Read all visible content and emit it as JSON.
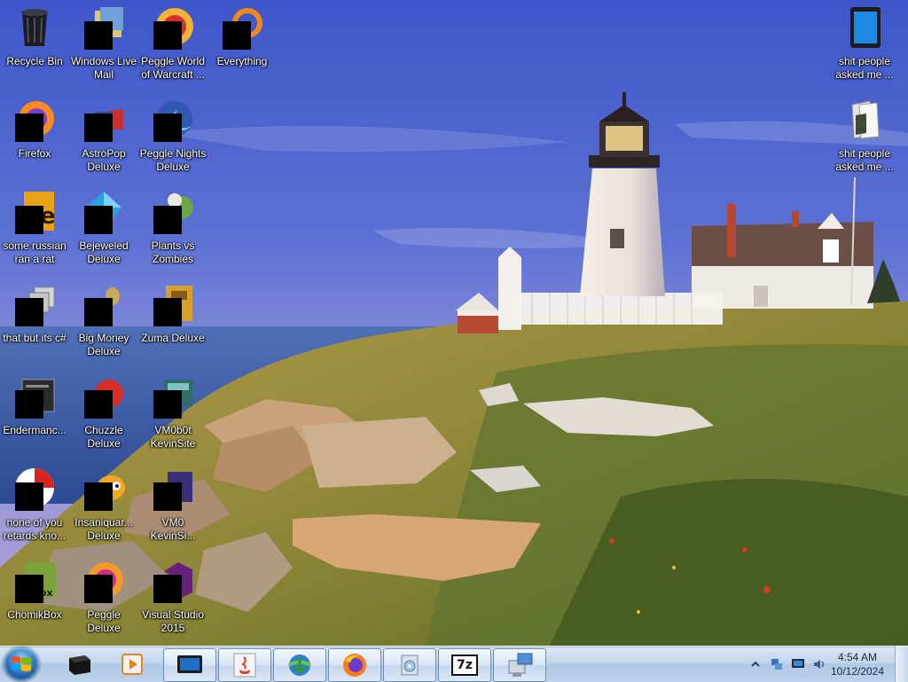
{
  "desktop": {
    "icons": [
      {
        "label": "Recycle Bin",
        "icon": "recycle-bin-icon",
        "name": "icon-recycle-bin"
      },
      {
        "label": "Windows Live Mail",
        "icon": "mail-app-icon",
        "name": "icon-windows-live-mail"
      },
      {
        "label": "Peggle World of Warcraft ...",
        "icon": "game-icon",
        "name": "icon-peggle-wow"
      },
      {
        "label": "Everything",
        "icon": "search-app-icon",
        "name": "icon-everything"
      },
      {
        "label": "Firefox",
        "icon": "firefox-icon",
        "name": "icon-firefox"
      },
      {
        "label": "AstroPop Deluxe",
        "icon": "game-icon",
        "name": "icon-astropop-deluxe"
      },
      {
        "label": "Peggle Nights Deluxe",
        "icon": "game-icon",
        "name": "icon-peggle-nights-deluxe"
      },
      {
        "label": "some russian ran a rat",
        "icon": "app-icon",
        "name": "icon-some-russian-ran-a-rat"
      },
      {
        "label": "Bejeweled Deluxe",
        "icon": "game-icon",
        "name": "icon-bejeweled-deluxe"
      },
      {
        "label": "Plants vs Zombies",
        "icon": "game-icon",
        "name": "icon-plants-vs-zombies"
      },
      {
        "label": "that but its c#",
        "icon": "app-icon",
        "name": "icon-that-but-its-csharp"
      },
      {
        "label": "Big Money Deluxe",
        "icon": "game-icon",
        "name": "icon-big-money-deluxe"
      },
      {
        "label": "Zuma Deluxe",
        "icon": "game-icon",
        "name": "icon-zuma-deluxe"
      },
      {
        "label": "Endermanc...",
        "icon": "terminal-icon",
        "name": "icon-endermanc"
      },
      {
        "label": "Chuzzle Deluxe",
        "icon": "game-icon",
        "name": "icon-chuzzle-deluxe"
      },
      {
        "label": "VM0b0t KevinSite",
        "icon": "app-icon",
        "name": "icon-vm0b0t-kevinsite"
      },
      {
        "label": "none of you retards kno...",
        "icon": "app-icon",
        "name": "icon-none-of-you"
      },
      {
        "label": "Insaniquar... Deluxe",
        "icon": "game-icon",
        "name": "icon-insaniquarium-deluxe"
      },
      {
        "label": "VM0 KevinSi...",
        "icon": "app-icon",
        "name": "icon-vm0-kevinsite"
      },
      {
        "label": "ChomikBox",
        "icon": "app-icon",
        "name": "icon-chomikbox"
      },
      {
        "label": "Peggle Deluxe",
        "icon": "game-icon",
        "name": "icon-peggle-deluxe"
      },
      {
        "label": "Visual Studio 2015",
        "icon": "visual-studio-icon",
        "name": "icon-visual-studio-2015"
      },
      {
        "label": "shit people asked me ...",
        "icon": "tablet-icon",
        "name": "icon-shit-people-asked-1"
      },
      {
        "label": "shit people asked me ...",
        "icon": "folder-icon",
        "name": "icon-shit-people-asked-2"
      }
    ]
  },
  "taskbar": {
    "start": {
      "icon": "windows-logo-icon"
    },
    "items": [
      {
        "icon": "black-box-icon",
        "name": "taskbar-pinned-1",
        "state": "pinned"
      },
      {
        "icon": "media-player-icon",
        "name": "taskbar-pinned-media",
        "state": "pinned"
      },
      {
        "icon": "monitor-icon",
        "name": "taskbar-monitor",
        "state": "open"
      },
      {
        "icon": "java-icon",
        "name": "taskbar-java",
        "state": "open"
      },
      {
        "icon": "download-manager-icon",
        "name": "taskbar-download-manager",
        "state": "open"
      },
      {
        "icon": "firefox-icon",
        "name": "taskbar-firefox",
        "state": "open"
      },
      {
        "icon": "installer-icon",
        "name": "taskbar-installer",
        "state": "open"
      },
      {
        "icon": "7zip-icon",
        "name": "taskbar-7zip",
        "state": "open",
        "text": "7z"
      },
      {
        "icon": "network-setup-icon",
        "name": "taskbar-network-setup",
        "state": "open"
      }
    ],
    "tray": {
      "icons": [
        "show-hidden-icons-chevron",
        "network-icon",
        "display-icon",
        "volume-icon"
      ],
      "time": "4:54 AM",
      "date": "10/12/2024"
    }
  }
}
